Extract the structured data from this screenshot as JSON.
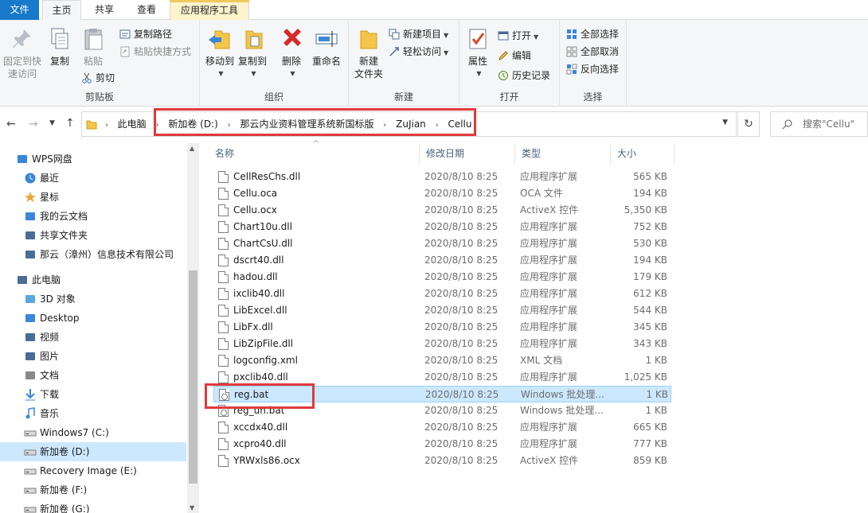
{
  "tabs": {
    "file": "文件",
    "home": "主页",
    "share": "共享",
    "view": "查看",
    "app_tools": "应用程序工具"
  },
  "ribbon": {
    "clipboard": {
      "label": "剪贴板",
      "pin": "固定到快速访问",
      "pin_line1": "固定到快",
      "pin_line2": "速访问",
      "copy": "复制",
      "paste": "粘贴",
      "copy_path": "复制路径",
      "paste_shortcut": "粘贴快捷方式",
      "cut": "剪切"
    },
    "organize": {
      "label": "组织",
      "move_to": "移动到",
      "copy_to": "复制到",
      "delete": "删除",
      "rename": "重命名"
    },
    "new": {
      "label": "新建",
      "new_folder_l1": "新建",
      "new_folder_l2": "文件夹",
      "new_item": "新建项目",
      "easy_access": "轻松访问"
    },
    "open": {
      "label": "打开",
      "properties": "属性",
      "open": "打开",
      "edit": "编辑",
      "history": "历史记录"
    },
    "select": {
      "label": "选择",
      "select_all": "全部选择",
      "select_none": "全部取消",
      "invert": "反向选择"
    }
  },
  "address": {
    "crumbs": [
      "此电脑",
      "新加卷 (D:)",
      "那云内业资料管理系统新国标版",
      "ZuJian",
      "Cellu"
    ],
    "search_placeholder": "搜索\"Cellu\""
  },
  "sidebar": [
    {
      "label": "WPS网盘",
      "icon": "wps-cloud-icon"
    },
    {
      "label": "最近",
      "icon": "clock-icon"
    },
    {
      "label": "星标",
      "icon": "star-icon"
    },
    {
      "label": "我的云文档",
      "icon": "cloud-doc-icon"
    },
    {
      "label": "共享文件夹",
      "icon": "shared-folder-icon"
    },
    {
      "label": "那云（漳州）信息技术有限公司",
      "icon": "company-icon"
    },
    {
      "label": "此电脑",
      "icon": "computer-icon"
    },
    {
      "label": "3D 对象",
      "icon": "cube-icon"
    },
    {
      "label": "Desktop",
      "icon": "desktop-icon"
    },
    {
      "label": "视频",
      "icon": "video-icon"
    },
    {
      "label": "图片",
      "icon": "picture-icon"
    },
    {
      "label": "文档",
      "icon": "document-icon"
    },
    {
      "label": "下载",
      "icon": "download-icon"
    },
    {
      "label": "音乐",
      "icon": "music-icon"
    },
    {
      "label": "Windows7 (C:)",
      "icon": "drive-icon"
    },
    {
      "label": "新加卷 (D:)",
      "icon": "drive-icon"
    },
    {
      "label": "Recovery Image (E:)",
      "icon": "drive-icon"
    },
    {
      "label": "新加卷 (F:)",
      "icon": "drive-icon"
    },
    {
      "label": "新加卷 (G:)",
      "icon": "drive-icon"
    }
  ],
  "columns": {
    "name": "名称",
    "date": "修改日期",
    "type": "类型",
    "size": "大小"
  },
  "files": [
    {
      "name": "CellResChs.dll",
      "date": "2020/8/10 8:25",
      "type": "应用程序扩展",
      "size": "565 KB"
    },
    {
      "name": "Cellu.oca",
      "date": "2020/8/10 8:25",
      "type": "OCA 文件",
      "size": "194 KB"
    },
    {
      "name": "Cellu.ocx",
      "date": "2020/8/10 8:25",
      "type": "ActiveX 控件",
      "size": "5,350 KB"
    },
    {
      "name": "Chart10u.dll",
      "date": "2020/8/10 8:25",
      "type": "应用程序扩展",
      "size": "752 KB"
    },
    {
      "name": "ChartCsU.dll",
      "date": "2020/8/10 8:25",
      "type": "应用程序扩展",
      "size": "530 KB"
    },
    {
      "name": "dscrt40.dll",
      "date": "2020/8/10 8:25",
      "type": "应用程序扩展",
      "size": "194 KB"
    },
    {
      "name": "hadou.dll",
      "date": "2020/8/10 8:25",
      "type": "应用程序扩展",
      "size": "179 KB"
    },
    {
      "name": "ixclib40.dll",
      "date": "2020/8/10 8:25",
      "type": "应用程序扩展",
      "size": "612 KB"
    },
    {
      "name": "LibExcel.dll",
      "date": "2020/8/10 8:25",
      "type": "应用程序扩展",
      "size": "544 KB"
    },
    {
      "name": "LibFx.dll",
      "date": "2020/8/10 8:25",
      "type": "应用程序扩展",
      "size": "345 KB"
    },
    {
      "name": "LibZipFile.dll",
      "date": "2020/8/10 8:25",
      "type": "应用程序扩展",
      "size": "343 KB"
    },
    {
      "name": "logconfig.xml",
      "date": "2020/8/10 8:25",
      "type": "XML 文档",
      "size": "1 KB"
    },
    {
      "name": "pxclib40.dll",
      "date": "2020/8/10 8:25",
      "type": "应用程序扩展",
      "size": "1,025 KB"
    },
    {
      "name": "reg.bat",
      "date": "2020/8/10 8:25",
      "type": "Windows 批处理...",
      "size": "1 KB"
    },
    {
      "name": "reg_un.bat",
      "date": "2020/8/10 8:25",
      "type": "Windows 批处理...",
      "size": "1 KB"
    },
    {
      "name": "xccdx40.dll",
      "date": "2020/8/10 8:25",
      "type": "应用程序扩展",
      "size": "665 KB"
    },
    {
      "name": "xcpro40.dll",
      "date": "2020/8/10 8:25",
      "type": "应用程序扩展",
      "size": "777 KB"
    },
    {
      "name": "YRWxls86.ocx",
      "date": "2020/8/10 8:25",
      "type": "ActiveX 控件",
      "size": "859 KB"
    }
  ],
  "selected_file": "reg.bat",
  "colors": {
    "accent": "#1979ca",
    "selection": "#cce8ff",
    "highlight_box": "#e03a3a"
  }
}
